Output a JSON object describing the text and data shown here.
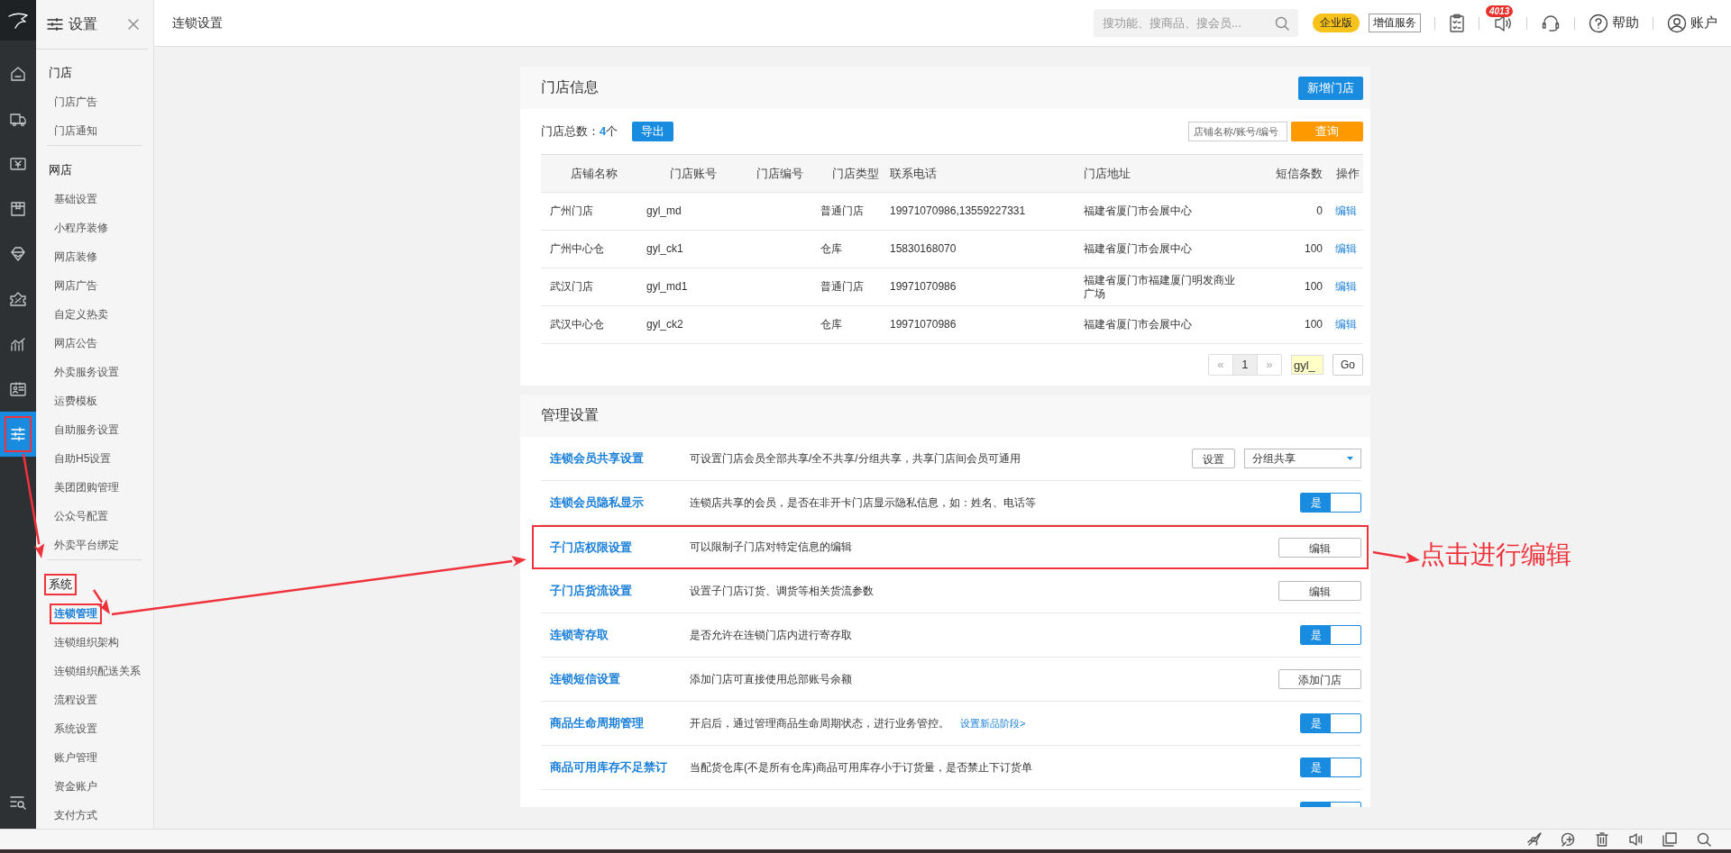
{
  "rail": {
    "items": [
      {
        "kind": "home",
        "selected": false,
        "highlighted": false
      },
      {
        "kind": "truck",
        "selected": false,
        "highlighted": false
      },
      {
        "kind": "cash",
        "selected": false,
        "highlighted": false
      },
      {
        "kind": "box",
        "selected": false,
        "highlighted": false
      },
      {
        "kind": "diamond",
        "selected": false,
        "highlighted": false
      },
      {
        "kind": "ticket",
        "selected": false,
        "highlighted": false
      },
      {
        "kind": "chart",
        "selected": false,
        "highlighted": false
      },
      {
        "kind": "card",
        "selected": false,
        "highlighted": false
      },
      {
        "kind": "sliders",
        "selected": true,
        "highlighted": true
      }
    ]
  },
  "sidebar": {
    "title": "设置",
    "groups": [
      {
        "title": "门店",
        "highlighted": false,
        "items": [
          {
            "label": "门店广告",
            "selected": false,
            "highlighted": false
          },
          {
            "label": "门店通知",
            "selected": false,
            "highlighted": false
          }
        ]
      },
      {
        "title": "网店",
        "highlighted": false,
        "items": [
          {
            "label": "基础设置",
            "selected": false,
            "highlighted": false
          },
          {
            "label": "小程序装修",
            "selected": false,
            "highlighted": false
          },
          {
            "label": "网店装修",
            "selected": false,
            "highlighted": false
          },
          {
            "label": "网店广告",
            "selected": false,
            "highlighted": false
          },
          {
            "label": "自定义热卖",
            "selected": false,
            "highlighted": false
          },
          {
            "label": "网店公告",
            "selected": false,
            "highlighted": false
          },
          {
            "label": "外卖服务设置",
            "selected": false,
            "highlighted": false
          },
          {
            "label": "运费模板",
            "selected": false,
            "highlighted": false
          },
          {
            "label": "自助服务设置",
            "selected": false,
            "highlighted": false
          },
          {
            "label": "自助H5设置",
            "selected": false,
            "highlighted": false
          },
          {
            "label": "美团团购管理",
            "selected": false,
            "highlighted": false
          },
          {
            "label": "公众号配置",
            "selected": false,
            "highlighted": false
          },
          {
            "label": "外卖平台绑定",
            "selected": false,
            "highlighted": false
          }
        ]
      },
      {
        "title": "系统",
        "highlighted": true,
        "items": [
          {
            "label": "连锁管理",
            "selected": true,
            "highlighted": true
          },
          {
            "label": "连锁组织架构",
            "selected": false,
            "highlighted": false
          },
          {
            "label": "连锁组织配送关系",
            "selected": false,
            "highlighted": false
          },
          {
            "label": "流程设置",
            "selected": false,
            "highlighted": false
          },
          {
            "label": "系统设置",
            "selected": false,
            "highlighted": false
          },
          {
            "label": "账户管理",
            "selected": false,
            "highlighted": false
          },
          {
            "label": "资金账户",
            "selected": false,
            "highlighted": false
          },
          {
            "label": "支付方式",
            "selected": false,
            "highlighted": false
          }
        ]
      }
    ]
  },
  "topbar": {
    "title": "连锁设置",
    "search": {
      "placeholder": "搜功能、搜商品、搜会员..."
    },
    "edition": "企业版",
    "value_service": "增值服务",
    "notification_count": "4013",
    "help": "帮助",
    "account": "账户"
  },
  "store_info": {
    "title": "门店信息",
    "add_button": "新增门店",
    "count_text": "门店总数：**4**个",
    "export_button": "导出",
    "search": {
      "placeholder": "店铺名称/账号/编号"
    },
    "query_button": "查询",
    "table": {
      "columns": [
        "店铺名称",
        "门店账号",
        "门店编号",
        "门店类型",
        "联系电话",
        "门店地址",
        "短信条数",
        "操作"
      ],
      "rows": [
        [
          "广州门店",
          "gyl_md",
          "",
          "普通门店",
          "19971070986,13559227331",
          "福建省厦门市会展中心",
          "0",
          "编辑"
        ],
        [
          "广州中心仓",
          "gyl_ck1",
          "",
          "仓库",
          "15830168070",
          "福建省厦门市会展中心",
          "100",
          "编辑"
        ],
        [
          "武汉门店",
          "gyl_md1",
          "",
          "普通门店",
          "19971070986",
          "福建省厦门市福建厦门明发商业广场",
          "100",
          "编辑"
        ],
        [
          "武汉中心仓",
          "gyl_ck2",
          "",
          "仓库",
          "19971070986",
          "福建省厦门市会展中心",
          "100",
          "编辑"
        ]
      ]
    },
    "pagination": {
      "prev": "«",
      "pages": [
        {
          "label": "1",
          "selected": true
        }
      ],
      "next": "»",
      "jump_value": "gyl_",
      "go": "Go"
    }
  },
  "management": {
    "title": "管理设置",
    "rows": [
      {
        "kind": "select",
        "name": "连锁会员共享设置",
        "description": "可设置门店会员全部共享/全不共享/分组共享，共享门店间会员可通用",
        "button": "设置",
        "value": "分组共享",
        "highlighted": false
      },
      {
        "kind": "toggle",
        "name": "连锁会员隐私显示",
        "description": "连锁店共享的会员，是否在非开卡门店显示隐私信息，如：姓名、电话等",
        "on": true,
        "label": "是",
        "highlighted": false
      },
      {
        "kind": "button",
        "name": "子门店权限设置",
        "description": "可以限制子门店对特定信息的编辑",
        "button": "编辑",
        "highlighted": true
      },
      {
        "kind": "button",
        "name": "子门店货流设置",
        "description": "设置子门店订货、调货等相关货流参数",
        "button": "编辑",
        "highlighted": false
      },
      {
        "kind": "toggle",
        "name": "连锁寄存取",
        "description": "是否允许在连锁门店内进行寄存取",
        "on": true,
        "label": "是",
        "highlighted": false
      },
      {
        "kind": "button",
        "name": "连锁短信设置",
        "description": "添加门店可直接使用总部账号余额",
        "button": "添加门店",
        "highlighted": false
      },
      {
        "kind": "toggle",
        "name": "商品生命周期管理",
        "description": "开启后，通过管理商品生命周期状态，进行业务管控。",
        "link": "设置新品阶段>",
        "on": true,
        "label": "是",
        "highlighted": false
      },
      {
        "kind": "toggle",
        "name": "商品可用库存不足禁订",
        "description": "当配货仓库(不是所有仓库)商品可用库存小于订货量，是否禁止下订货单",
        "on": true,
        "label": "是",
        "highlighted": false
      },
      {
        "kind": "toggle",
        "on": true,
        "highlighted": false
      }
    ]
  },
  "annotation": {
    "callout": "点击进行编辑"
  }
}
